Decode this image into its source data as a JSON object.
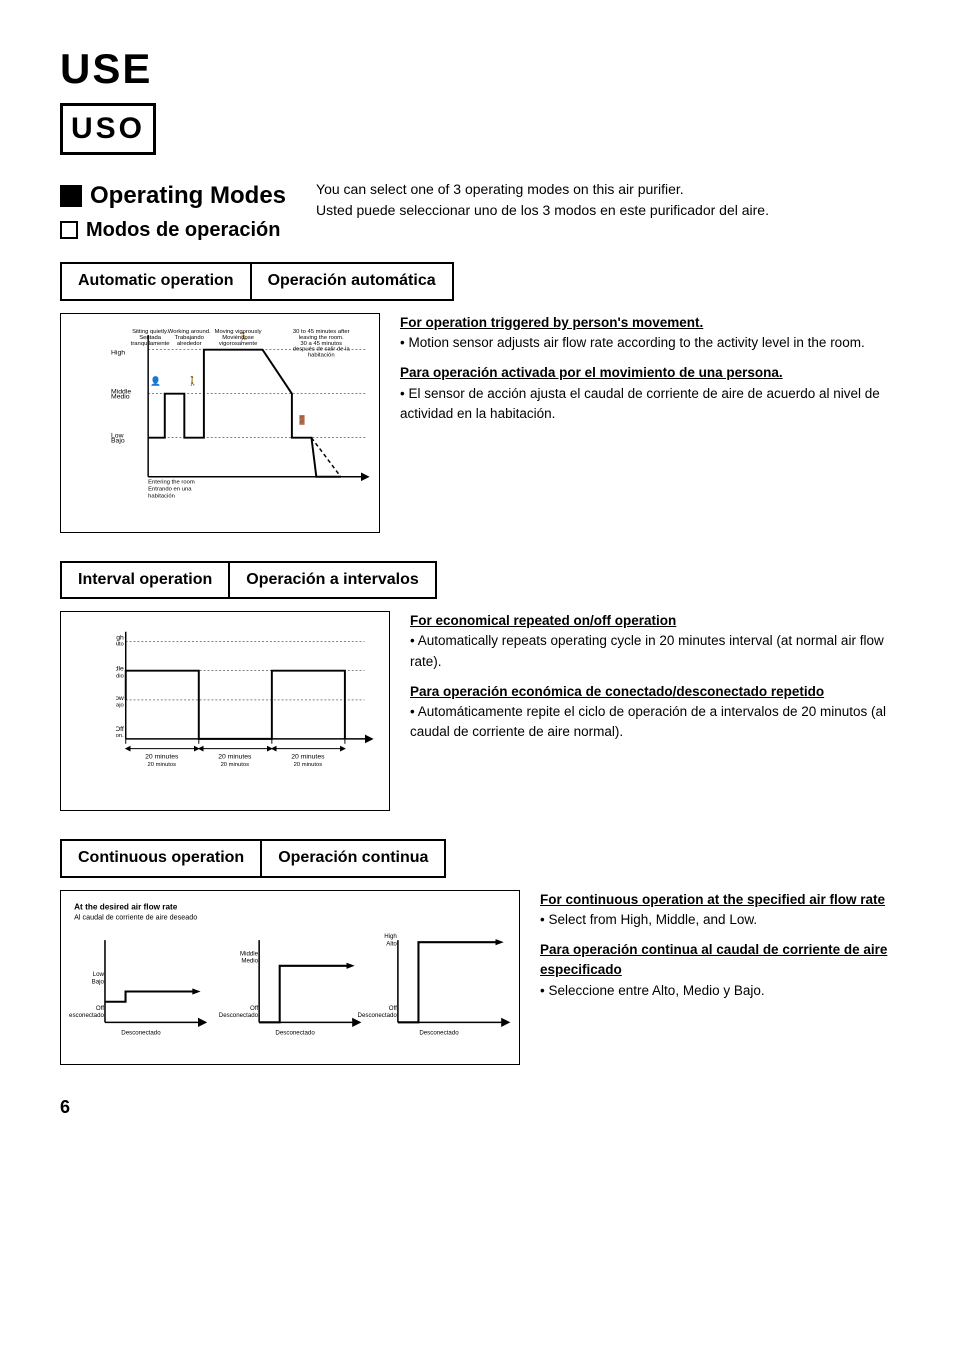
{
  "page": {
    "title_en": "USE",
    "title_es": "USO",
    "page_number": "6"
  },
  "operating_modes": {
    "heading_en": "Operating Modes",
    "heading_es": "Modos de operación",
    "desc_en": "You can select one of 3 operating modes on this air purifier.",
    "desc_es": "Usted puede seleccionar uno de los 3 modos en este purificador del aire."
  },
  "automatic": {
    "label_en": "Automatic operation",
    "label_es": "Operación automática",
    "trigger_heading": "For operation triggered by person's movement.",
    "bullet1_en": "Motion sensor adjusts air flow rate according to the activity level in the room.",
    "spanish_heading": "Para operación activada por el movimiento de una persona.",
    "bullet1_es": "El sensor de acción ajusta el caudal de corriente de aire de acuerdo al nivel de actividad en la habitación."
  },
  "interval": {
    "label_en": "Interval operation",
    "label_es": "Operación a intervalos",
    "eco_heading": "For economical repeated on/off operation",
    "bullet1_en": "Automatically repeats operating cycle in 20 minutes interval (at normal air flow rate).",
    "spanish_heading": "Para operación económica de conectado/desconectado repetido",
    "bullet1_es": "Automáticamente repite el ciclo de operación de a intervalos de 20 minutos (al caudal de corriente de aire normal).",
    "y_high": "High\nAlto",
    "y_middle": "Middle\nMedio",
    "y_low": "Low\nBajo",
    "y_off": "Off\nDesconectado",
    "x1": "20 minutes\n20 minutos",
    "x2": "20 minutes\n20 minutos",
    "x3": "20 minutes\n20 minutos"
  },
  "continuous": {
    "label_en": "Continuous operation",
    "label_es": "Operación continua",
    "chart_title_en": "At the desired air flow rate",
    "chart_title_es": "Al caudal de corriente de aire deseado",
    "cont_heading": "For continuous operation at the specified air flow rate",
    "bullet1_en": "Select from High, Middle, and Low.",
    "spanish_heading": "Para operación continua al caudal de corriente de aire especificado",
    "bullet1_es": "Seleccione entre Alto, Medio y Bajo."
  },
  "auto_diagram": {
    "labels": {
      "sitting": "Sitting quietly.\nSentada\ntranquilamente",
      "working": "Working around.\nTrabajando\nalrededor",
      "moving": "Moving vigorously\nMoviéndose\nvigorosamente",
      "leaving": "30 to 45 minutes after\nleaving the room.\n30 a 45 minutos\ndespués de salir de la\nhabitación",
      "high": "High",
      "middle": "Middle\nMedio",
      "low": "Low\nBajo",
      "entering": "Entering the room\nEntrando en una\nhabitación"
    }
  }
}
